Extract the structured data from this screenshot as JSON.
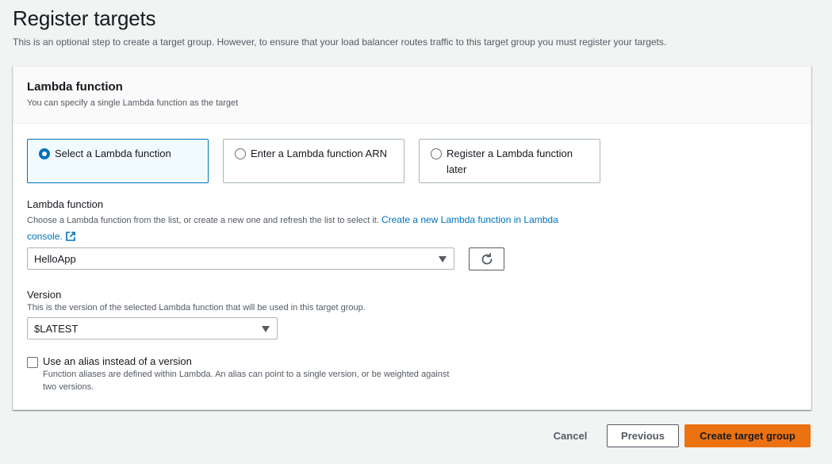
{
  "page": {
    "title": "Register targets",
    "description": "This is an optional step to create a target group. However, to ensure that your load balancer routes traffic to this target group you must register your targets."
  },
  "lambda_section": {
    "title": "Lambda function",
    "subtitle": "You can specify a single Lambda function as the target",
    "options": [
      {
        "label": "Select a Lambda function",
        "selected": true
      },
      {
        "label": "Enter a Lambda function ARN",
        "selected": false
      },
      {
        "label": "Register a Lambda function later",
        "selected": false
      }
    ]
  },
  "function_field": {
    "label": "Lambda function",
    "description": "Choose a Lambda function from the list, or create a new one and refresh the list to select it.",
    "link_text": "Create a new Lambda function in Lambda console.",
    "value": "HelloApp",
    "refresh_icon": "refresh-icon",
    "external_icon": "external-link-icon"
  },
  "version_field": {
    "label": "Version",
    "description": "This is the version of the selected Lambda function that will be used in this target group.",
    "value": "$LATEST"
  },
  "alias_option": {
    "label": "Use an alias instead of a version",
    "description": "Function aliases are defined within Lambda. An alias can point to a single version, or be weighted against two versions.",
    "checked": false
  },
  "footer": {
    "cancel_label": "Cancel",
    "previous_label": "Previous",
    "submit_label": "Create target group"
  },
  "colors": {
    "accent": "#0073bb",
    "primary_button": "#ec7211"
  }
}
